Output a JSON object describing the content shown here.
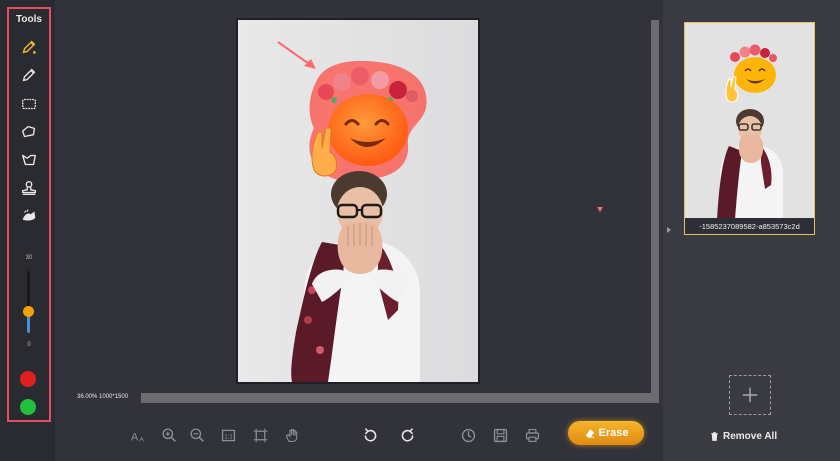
{
  "tools": {
    "title": "Tools",
    "items": [
      {
        "name": "magic-brush",
        "icon": "magic-pencil-icon",
        "active": true
      },
      {
        "name": "pencil",
        "icon": "pencil-icon"
      },
      {
        "name": "rectangle-select",
        "icon": "rect-select-icon"
      },
      {
        "name": "lasso",
        "icon": "lasso-icon"
      },
      {
        "name": "polygon-lasso",
        "icon": "polygon-lasso-icon"
      },
      {
        "name": "stamp",
        "icon": "stamp-icon"
      },
      {
        "name": "eraser",
        "icon": "eraser-icon"
      }
    ],
    "brush_size": {
      "max_label": "30",
      "min_label": "0",
      "value_fraction": 0.35
    },
    "colors": {
      "keep": "#e02020",
      "erase": "#22c03a"
    }
  },
  "canvas": {
    "zoom_info": "36.00% 1000*1500",
    "overlay_color": "#ff5a4e"
  },
  "toolbar": {
    "items": [
      {
        "icon": "font-size-icon"
      },
      {
        "icon": "zoom-in-icon"
      },
      {
        "icon": "zoom-out-icon"
      },
      {
        "icon": "actual-size-icon"
      },
      {
        "icon": "fit-screen-icon"
      },
      {
        "icon": "hand-icon"
      },
      {
        "icon": "undo-icon"
      },
      {
        "icon": "redo-icon"
      },
      {
        "icon": "history-icon"
      },
      {
        "icon": "save-icon"
      },
      {
        "icon": "print-icon"
      }
    ],
    "erase_label": "Erase"
  },
  "right_panel": {
    "thumbnail_caption": "-1585237089582-a853573c2d",
    "remove_all_label": "Remove All"
  }
}
